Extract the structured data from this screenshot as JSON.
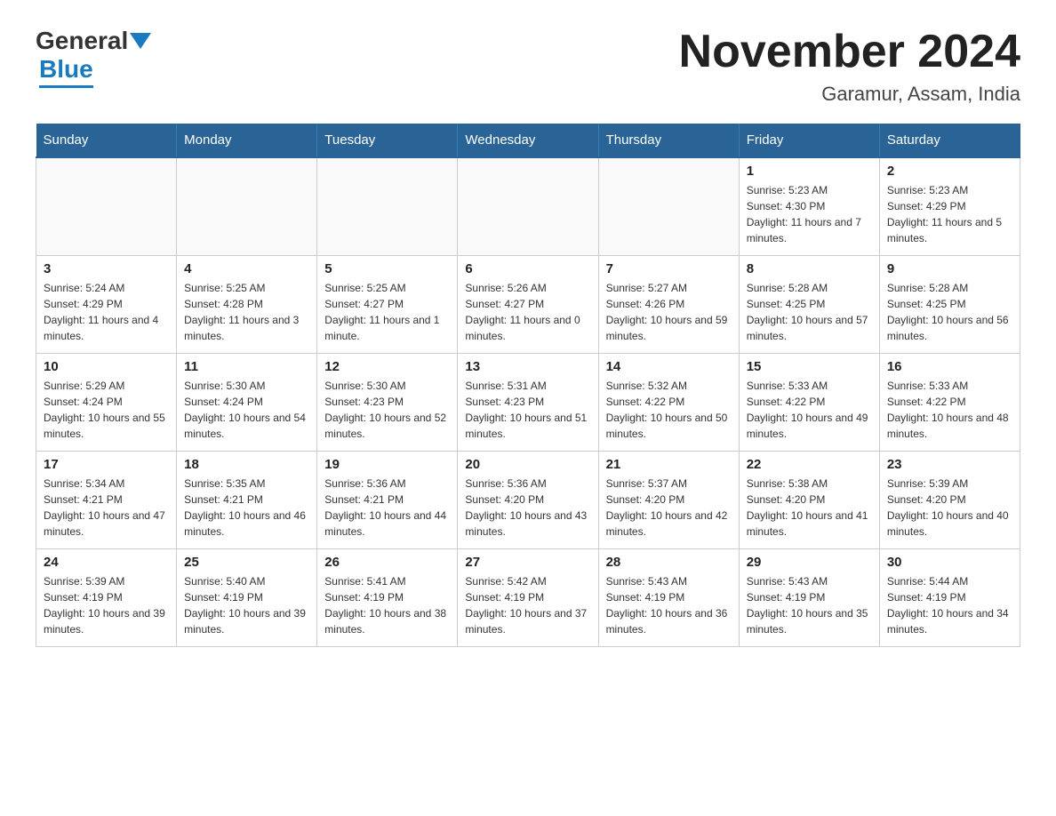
{
  "header": {
    "logo_general": "General",
    "logo_blue": "Blue",
    "title": "November 2024",
    "subtitle": "Garamur, Assam, India"
  },
  "days_of_week": [
    "Sunday",
    "Monday",
    "Tuesday",
    "Wednesday",
    "Thursday",
    "Friday",
    "Saturday"
  ],
  "weeks": [
    [
      {
        "day": "",
        "info": ""
      },
      {
        "day": "",
        "info": ""
      },
      {
        "day": "",
        "info": ""
      },
      {
        "day": "",
        "info": ""
      },
      {
        "day": "",
        "info": ""
      },
      {
        "day": "1",
        "info": "Sunrise: 5:23 AM\nSunset: 4:30 PM\nDaylight: 11 hours and 7 minutes."
      },
      {
        "day": "2",
        "info": "Sunrise: 5:23 AM\nSunset: 4:29 PM\nDaylight: 11 hours and 5 minutes."
      }
    ],
    [
      {
        "day": "3",
        "info": "Sunrise: 5:24 AM\nSunset: 4:29 PM\nDaylight: 11 hours and 4 minutes."
      },
      {
        "day": "4",
        "info": "Sunrise: 5:25 AM\nSunset: 4:28 PM\nDaylight: 11 hours and 3 minutes."
      },
      {
        "day": "5",
        "info": "Sunrise: 5:25 AM\nSunset: 4:27 PM\nDaylight: 11 hours and 1 minute."
      },
      {
        "day": "6",
        "info": "Sunrise: 5:26 AM\nSunset: 4:27 PM\nDaylight: 11 hours and 0 minutes."
      },
      {
        "day": "7",
        "info": "Sunrise: 5:27 AM\nSunset: 4:26 PM\nDaylight: 10 hours and 59 minutes."
      },
      {
        "day": "8",
        "info": "Sunrise: 5:28 AM\nSunset: 4:25 PM\nDaylight: 10 hours and 57 minutes."
      },
      {
        "day": "9",
        "info": "Sunrise: 5:28 AM\nSunset: 4:25 PM\nDaylight: 10 hours and 56 minutes."
      }
    ],
    [
      {
        "day": "10",
        "info": "Sunrise: 5:29 AM\nSunset: 4:24 PM\nDaylight: 10 hours and 55 minutes."
      },
      {
        "day": "11",
        "info": "Sunrise: 5:30 AM\nSunset: 4:24 PM\nDaylight: 10 hours and 54 minutes."
      },
      {
        "day": "12",
        "info": "Sunrise: 5:30 AM\nSunset: 4:23 PM\nDaylight: 10 hours and 52 minutes."
      },
      {
        "day": "13",
        "info": "Sunrise: 5:31 AM\nSunset: 4:23 PM\nDaylight: 10 hours and 51 minutes."
      },
      {
        "day": "14",
        "info": "Sunrise: 5:32 AM\nSunset: 4:22 PM\nDaylight: 10 hours and 50 minutes."
      },
      {
        "day": "15",
        "info": "Sunrise: 5:33 AM\nSunset: 4:22 PM\nDaylight: 10 hours and 49 minutes."
      },
      {
        "day": "16",
        "info": "Sunrise: 5:33 AM\nSunset: 4:22 PM\nDaylight: 10 hours and 48 minutes."
      }
    ],
    [
      {
        "day": "17",
        "info": "Sunrise: 5:34 AM\nSunset: 4:21 PM\nDaylight: 10 hours and 47 minutes."
      },
      {
        "day": "18",
        "info": "Sunrise: 5:35 AM\nSunset: 4:21 PM\nDaylight: 10 hours and 46 minutes."
      },
      {
        "day": "19",
        "info": "Sunrise: 5:36 AM\nSunset: 4:21 PM\nDaylight: 10 hours and 44 minutes."
      },
      {
        "day": "20",
        "info": "Sunrise: 5:36 AM\nSunset: 4:20 PM\nDaylight: 10 hours and 43 minutes."
      },
      {
        "day": "21",
        "info": "Sunrise: 5:37 AM\nSunset: 4:20 PM\nDaylight: 10 hours and 42 minutes."
      },
      {
        "day": "22",
        "info": "Sunrise: 5:38 AM\nSunset: 4:20 PM\nDaylight: 10 hours and 41 minutes."
      },
      {
        "day": "23",
        "info": "Sunrise: 5:39 AM\nSunset: 4:20 PM\nDaylight: 10 hours and 40 minutes."
      }
    ],
    [
      {
        "day": "24",
        "info": "Sunrise: 5:39 AM\nSunset: 4:19 PM\nDaylight: 10 hours and 39 minutes."
      },
      {
        "day": "25",
        "info": "Sunrise: 5:40 AM\nSunset: 4:19 PM\nDaylight: 10 hours and 39 minutes."
      },
      {
        "day": "26",
        "info": "Sunrise: 5:41 AM\nSunset: 4:19 PM\nDaylight: 10 hours and 38 minutes."
      },
      {
        "day": "27",
        "info": "Sunrise: 5:42 AM\nSunset: 4:19 PM\nDaylight: 10 hours and 37 minutes."
      },
      {
        "day": "28",
        "info": "Sunrise: 5:43 AM\nSunset: 4:19 PM\nDaylight: 10 hours and 36 minutes."
      },
      {
        "day": "29",
        "info": "Sunrise: 5:43 AM\nSunset: 4:19 PM\nDaylight: 10 hours and 35 minutes."
      },
      {
        "day": "30",
        "info": "Sunrise: 5:44 AM\nSunset: 4:19 PM\nDaylight: 10 hours and 34 minutes."
      }
    ]
  ]
}
